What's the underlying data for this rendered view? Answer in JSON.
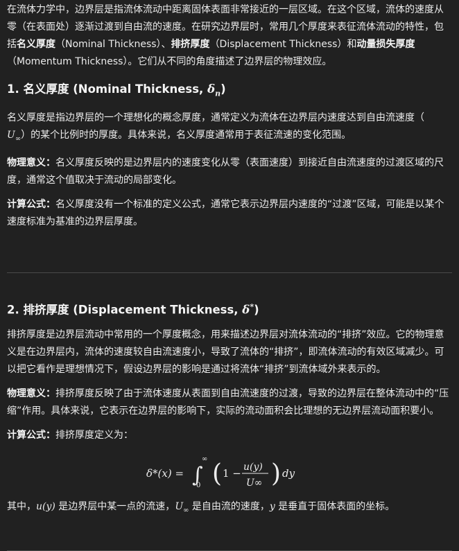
{
  "intro": {
    "p1": "在流体力学中，边界层是指流体流动中距离固体表面非常接近的一层区域。在这个区域，流体的速度从零（在表面处）逐渐过渡到自由流的速度。在研究边界层时，常用几个厚度来表征流体流动的特性，包括",
    "nominal_cn": "名义厚度",
    "nominal_en": "（Nominal Thickness）、",
    "displacement_cn": "排挤厚度",
    "displacement_en": "（Displacement Thickness）和",
    "momentum_cn": "动量损失厚度",
    "momentum_en": "（Momentum Thickness）。它们从不同的角度描述了边界层的物理效应。"
  },
  "section1": {
    "heading": "1. 名义厚度 (Nominal Thickness, ",
    "heading_sym": "δ",
    "heading_sub": "n",
    "heading_close": ")",
    "p1a": "名义厚度是指边界层的一个理想化的概念厚度，通常定义为流体在边界层内速度达到自由流速度（",
    "p1_sym": "U",
    "p1_sub": "∞",
    "p1b": "）的某个比例时的厚度。具体来说，名义厚度通常用于表征流速的变化范围。",
    "phys_label": "物理意义：",
    "phys_text": "名义厚度反映的是边界层内的速度变化从零（表面速度）到接近自由流速度的过渡区域的尺度，通常这个值取决于流动的局部变化。",
    "calc_label": "计算公式：",
    "calc_text": "名义厚度没有一个标准的定义公式，通常它表示边界层内速度的“过渡”区域，可能是以某个速度标准为基准的边界层厚度。"
  },
  "section2": {
    "heading": "2. 排挤厚度 (Displacement Thickness, ",
    "heading_sym": "δ",
    "heading_sup": "*",
    "heading_close": ")",
    "p1": "排挤厚度是边界层流动中常用的一个厚度概念，用来描述边界层对流体流动的“排挤”效应。它的物理意义是在边界层内，流体的速度较自由流速度小，导致了流体的“排挤”，即流体流动的有效区域减少。可以把它看作是理想情况下，假设边界层的影响是通过将流体“排挤”到流体域外来表示的。",
    "phys_label": "物理意义：",
    "phys_text": "排挤厚度反映了由于流体速度从表面到自由流速度的过渡，导致的边界层在整体流动中的“压缩”作用。具体来说，它表示在边界层的影响下，实际的流动面积会比理想的无边界层流动面积要小。",
    "calc_label": "计算公式：",
    "calc_text": "排挤厚度定义为：",
    "formula": {
      "lhs": "δ*(x) =",
      "upper": "∞",
      "lower": "0",
      "one": "1 −",
      "num": "u(y)",
      "den": "U∞",
      "dy": "dy"
    },
    "where_a": "其中，",
    "where_u": "u(y)",
    "where_b": " 是边界层中某一点的流速，",
    "where_U": "U",
    "where_Usub": "∞",
    "where_c": " 是自由流的速度，",
    "where_y": "y",
    "where_d": " 是垂直于固体表面的坐标。"
  }
}
